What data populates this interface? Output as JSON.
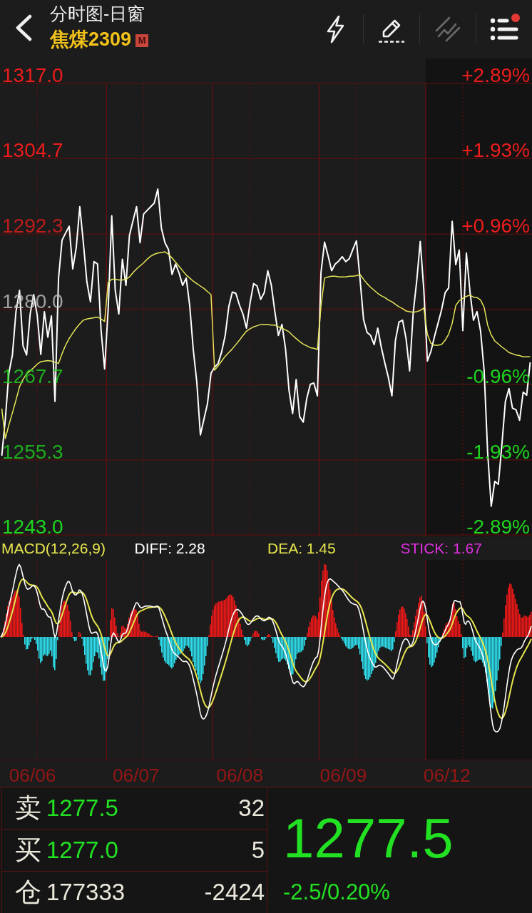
{
  "header": {
    "title": "分时图-日窗",
    "contract": "焦煤2309",
    "badge": "M",
    "actions": [
      {
        "kind": "flash",
        "disabled": false,
        "dot": false
      },
      {
        "kind": "draw",
        "disabled": false,
        "dot": false
      },
      {
        "kind": "trend",
        "disabled": true,
        "dot": false
      },
      {
        "kind": "list",
        "disabled": false,
        "dot": true
      }
    ]
  },
  "price_chart": {
    "percent_labels": [
      "+2.89%",
      "+1.93%",
      "+0.96%",
      "-0.96%",
      "-1.93%",
      "-2.89%"
    ],
    "dates": [
      "06/06",
      "06/07",
      "06/08",
      "06/09",
      "06/12"
    ],
    "chart_data": {
      "type": "line",
      "grid": true,
      "ylim": [
        1243,
        1317
      ],
      "categories": [
        null,
        null,
        null,
        null,
        null,
        null,
        null,
        null,
        null,
        null,
        null,
        null,
        null,
        null,
        null,
        null,
        null,
        null,
        null,
        null,
        null,
        null,
        null,
        null,
        null,
        null,
        null,
        null,
        null,
        null,
        null,
        null,
        null,
        null,
        null,
        null,
        null,
        null,
        null,
        null,
        null,
        null,
        null,
        null,
        null,
        null,
        null,
        null,
        null,
        null,
        null,
        null,
        null,
        null,
        null,
        null,
        null,
        null,
        null,
        null,
        null,
        null,
        null,
        null,
        null,
        null,
        null,
        null,
        null,
        null,
        null,
        null,
        null,
        null,
        null,
        null,
        null,
        null,
        null,
        null,
        null,
        null,
        null,
        null,
        null,
        null,
        null,
        null,
        null,
        null,
        null,
        null,
        null,
        null,
        null,
        null,
        null,
        null,
        null,
        null,
        null,
        null,
        null,
        null,
        null,
        null,
        null,
        null,
        null,
        null,
        null,
        null,
        null,
        null,
        null,
        null,
        null,
        null,
        null,
        null,
        null,
        null,
        null,
        null,
        null,
        null,
        null,
        null,
        null,
        null,
        null,
        null,
        null,
        null,
        null,
        null,
        null,
        null,
        null,
        null,
        null,
        null,
        null,
        null,
        null,
        null,
        null,
        null,
        null,
        null
      ],
      "yticks": [
        {
          "value": 1317,
          "label": "1317.0"
        },
        {
          "value": 1304.7,
          "label": "1304.7"
        },
        {
          "value": 1292.3,
          "label": "1292.3"
        },
        {
          "value": 1280,
          "label": "1280.0"
        },
        {
          "value": 1267.7,
          "label": "1267.7"
        },
        {
          "value": 1255.3,
          "label": "1255.3"
        },
        {
          "value": 1243,
          "label": "1243.0"
        }
      ],
      "series": [
        {
          "color": "#ffffff",
          "values": [
            1256.0,
            1262.0,
            1269.5,
            1272.5,
            1279.6,
            1283.1,
            1274.0,
            1272.5,
            1279.2,
            1282.4,
            1279.0,
            1272.6,
            1279.6,
            1275.4,
            1278.9,
            1264.9,
            1285.1,
            1291.3,
            1292.5,
            1293.6,
            1286.6,
            1290.1,
            1296.8,
            1290.9,
            1284.5,
            1281.2,
            1287.8,
            1287.4,
            1276.6,
            1270.2,
            1280.0,
            1295.3,
            1283.1,
            1279.2,
            1288.2,
            1283.9,
            1292.1,
            1294.5,
            1296.8,
            1290.9,
            1295.6,
            1296.2,
            1296.8,
            1297.4,
            1299.7,
            1293.3,
            1290.9,
            1289.8,
            1285.7,
            1287.4,
            1285.9,
            1283.9,
            1285.1,
            1280.5,
            1273.4,
            1268.0,
            1259.4,
            1262.0,
            1264.5,
            1269.5,
            1270.5,
            1271.1,
            1273.0,
            1275.7,
            1280.4,
            1282.8,
            1282.6,
            1280.7,
            1279.2,
            1276.9,
            1281.0,
            1284.2,
            1283.8,
            1281.6,
            1282.7,
            1286.3,
            1283.9,
            1279.6,
            1275.7,
            1277.5,
            1273.5,
            1266.7,
            1262.9,
            1268.5,
            1262.4,
            1261.5,
            1265.4,
            1267.7,
            1267.9,
            1265.8,
            1286.0,
            1291.0,
            1288.8,
            1286.3,
            1287.4,
            1287.9,
            1288.6,
            1287.8,
            1288.3,
            1289.8,
            1291.2,
            1285.0,
            1278.3,
            1276.2,
            1275.7,
            1274.2,
            1276.9,
            1273.8,
            1271.2,
            1268.8,
            1265.8,
            1274.9,
            1277.9,
            1278.2,
            1275.2,
            1269.9,
            1279.4,
            1284.7,
            1291.1,
            1283.2,
            1271.5,
            1273.1,
            1275.5,
            1277.7,
            1279.9,
            1282.7,
            1283.5,
            1294.4,
            1287.3,
            1289.7,
            1276.5,
            1289.2,
            1282.9,
            1278.2,
            1279.6,
            1276.4,
            1269.9,
            1256.5,
            1247.7,
            1251.8,
            1251.3,
            1257.7,
            1264.9,
            1267.0,
            1263.8,
            1263.5,
            1261.8,
            1266.4,
            1265.9,
            1271.3
          ]
        },
        {
          "color": "#e6e65a",
          "values": [
            1263.7,
            1258.8,
            1261.0,
            1263.0,
            1265.1,
            1267.3,
            1268.5,
            1269.4,
            1269.9,
            1270.4,
            1271.0,
            1271.4,
            1271.5,
            1271.6,
            1271.5,
            1271.3,
            1271.1,
            1272.7,
            1274.1,
            1275.2,
            1276.1,
            1276.9,
            1277.6,
            1278.2,
            1278.4,
            1278.5,
            1278.6,
            1278.7,
            1278.4,
            1278.0,
            1284.4,
            1284.9,
            1284.9,
            1284.8,
            1284.8,
            1284.9,
            1285.3,
            1286.0,
            1286.6,
            1287.1,
            1287.6,
            1288.2,
            1288.7,
            1289.0,
            1289.2,
            1289.3,
            1289.4,
            1289.0,
            1288.4,
            1287.7,
            1287.0,
            1286.3,
            1285.6,
            1285.1,
            1284.6,
            1284.2,
            1283.8,
            1283.4,
            1282.9,
            1282.4,
            1270.0,
            1270.7,
            1271.5,
            1272.3,
            1272.9,
            1273.5,
            1274.2,
            1274.9,
            1275.7,
            1276.4,
            1276.8,
            1277.1,
            1277.3,
            1277.5,
            1277.5,
            1277.5,
            1277.4,
            1277.4,
            1277.1,
            1276.9,
            1276.6,
            1276.3,
            1275.7,
            1275.2,
            1274.7,
            1274.3,
            1274.0,
            1273.7,
            1273.6,
            1273.4,
            1280.5,
            1285.1,
            1285.3,
            1285.4,
            1285.4,
            1285.3,
            1285.3,
            1285.3,
            1285.4,
            1285.4,
            1285.5,
            1285.7,
            1284.9,
            1284.2,
            1283.6,
            1283.1,
            1282.6,
            1282.2,
            1281.9,
            1281.5,
            1281.2,
            1280.8,
            1280.4,
            1280.1,
            1279.7,
            1279.6,
            1279.5,
            1279.6,
            1279.8,
            1280.2,
            1275.9,
            1274.4,
            1274.1,
            1274.1,
            1274.2,
            1274.9,
            1275.9,
            1277.7,
            1280.6,
            1281.4,
            1281.8,
            1282.1,
            1282.3,
            1282.0,
            1281.9,
            1281.5,
            1280.3,
            1277.4,
            1275.8,
            1274.8,
            1274.3,
            1273.8,
            1273.4,
            1272.9,
            1272.7,
            1272.5,
            1272.4,
            1272.2,
            1272.2,
            1272.2
          ]
        }
      ]
    }
  },
  "macd": {
    "title": "MACD(12,26,9)",
    "readings": [
      {
        "text": "DIFF: 2.28",
        "color": "#ffffff"
      },
      {
        "text": "DEA: 1.45",
        "color": "#e6e64e"
      },
      {
        "text": "STICK: 1.67",
        "color": "#e030e0"
      }
    ]
  },
  "quote": {
    "rows": [
      {
        "kind": "sell",
        "label": "卖",
        "price": "1277.5",
        "volume": "32"
      },
      {
        "kind": "buy",
        "label": "买",
        "price": "1277.0",
        "volume": "5"
      },
      {
        "kind": "position",
        "label": "仓",
        "price": "177333",
        "volume": "-2424"
      }
    ],
    "last": "1277.5",
    "change": "-2.5/0.20%",
    "falling": true
  }
}
